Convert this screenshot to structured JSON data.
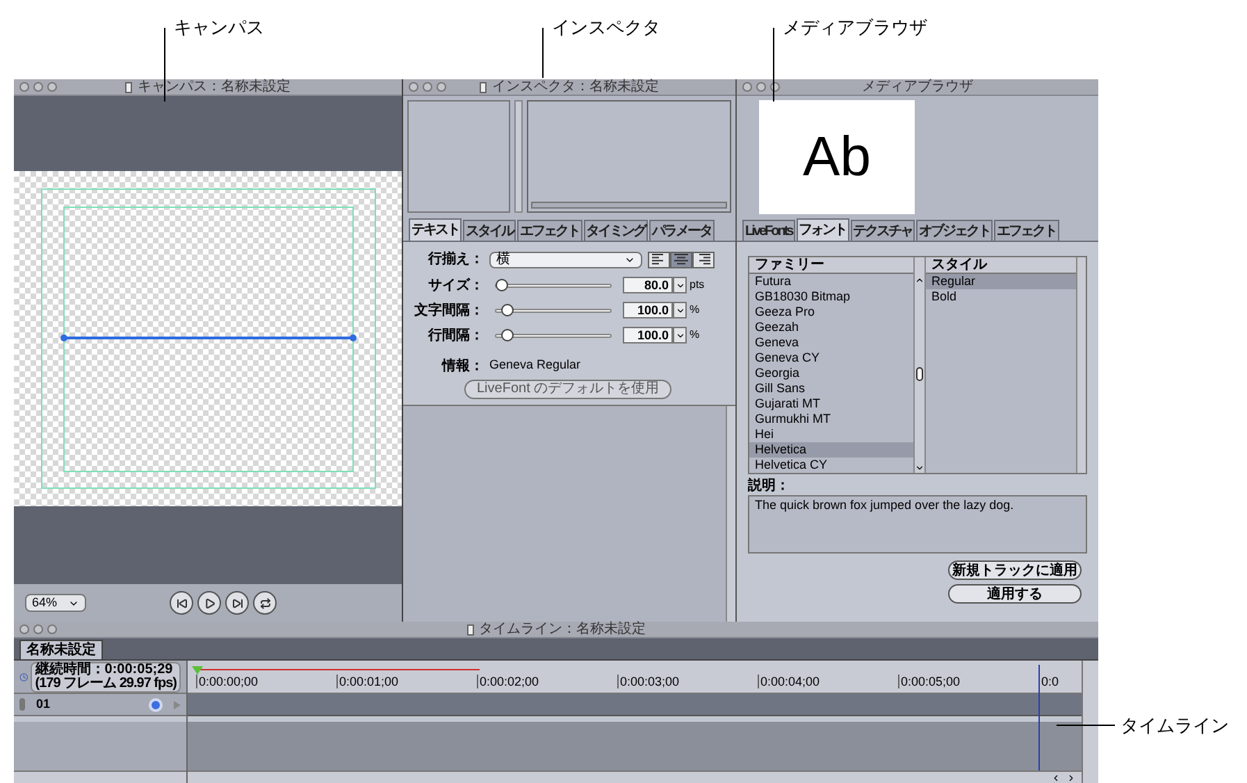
{
  "callouts": [
    {
      "label": "キャンパス"
    },
    {
      "label": "インスペクタ"
    },
    {
      "label": "メディアブラウザ"
    },
    {
      "label": "タイムライン"
    }
  ],
  "canvas": {
    "title": "キャンパス：名称未設定",
    "zoom": "64%"
  },
  "inspector": {
    "title": "インスペクタ：名称未設定",
    "tabs": [
      {
        "label": "テキスト",
        "selected": true
      },
      {
        "label": "スタイル",
        "selected": false
      },
      {
        "label": "エフェクト",
        "selected": false
      },
      {
        "label": "タイミング",
        "selected": false
      },
      {
        "label": "パラメータ",
        "selected": false
      }
    ],
    "alignment": {
      "label": "行揃え：",
      "value": "横",
      "options": [
        {
          "kind": "left",
          "selected": false
        },
        {
          "kind": "center",
          "selected": true
        },
        {
          "kind": "right",
          "selected": false
        }
      ]
    },
    "sliders": [
      {
        "label": "サイズ：",
        "level": 0.05,
        "value": "80.0",
        "unit": "pts"
      },
      {
        "label": "文字間隔：",
        "level": 0.1,
        "value": "100.0",
        "unit": "%"
      },
      {
        "label": "行間隔：",
        "level": 0.1,
        "value": "100.0",
        "unit": "%"
      }
    ],
    "info": {
      "label": "情報：",
      "value": "Geneva Regular"
    },
    "default_button": "LiveFont のデフォルトを使用"
  },
  "media_browser": {
    "title": "メディアブラウザ",
    "preview_text": "Ab",
    "tabs": [
      {
        "label": "LiveFonts",
        "selected": false
      },
      {
        "label": "フォント",
        "selected": true
      },
      {
        "label": "テクスチャ",
        "selected": false
      },
      {
        "label": "オブジェクト",
        "selected": false
      },
      {
        "label": "エフェクト",
        "selected": false
      }
    ],
    "family_header": "ファミリー",
    "style_header": "スタイル",
    "families": [
      {
        "name": "Futura",
        "selected": false
      },
      {
        "name": "GB18030 Bitmap",
        "selected": false
      },
      {
        "name": "Geeza Pro",
        "selected": false
      },
      {
        "name": "Geezah",
        "selected": false
      },
      {
        "name": "Geneva",
        "selected": false
      },
      {
        "name": "Geneva CY",
        "selected": false
      },
      {
        "name": "Georgia",
        "selected": false
      },
      {
        "name": "Gill Sans",
        "selected": false
      },
      {
        "name": "Gujarati MT",
        "selected": false
      },
      {
        "name": "Gurmukhi MT",
        "selected": false
      },
      {
        "name": "Hei",
        "selected": false
      },
      {
        "name": "Helvetica",
        "selected": true
      },
      {
        "name": "Helvetica CY",
        "selected": false
      }
    ],
    "styles": [
      {
        "name": "Regular",
        "selected": true
      },
      {
        "name": "Bold",
        "selected": false
      }
    ],
    "description_label": "説明：",
    "description": "The quick brown fox jumped over the lazy dog.",
    "buttons": [
      "新規トラックに適用",
      "適用する"
    ]
  },
  "timeline": {
    "title": "タイムライン：名称未設定",
    "tabs": [
      {
        "label": "名称未設定",
        "selected": true
      }
    ],
    "duration": "継続時間：0:00:05;29",
    "frames": "(179 フレーム 29.97 fps)",
    "ruler": [
      "0:00:00;00",
      "0:00:01;00",
      "0:00:02;00",
      "0:00:03;00",
      "0:00:04;00",
      "0:00:05;00",
      "0:0"
    ],
    "tracks": [
      {
        "name": "01"
      }
    ]
  }
}
